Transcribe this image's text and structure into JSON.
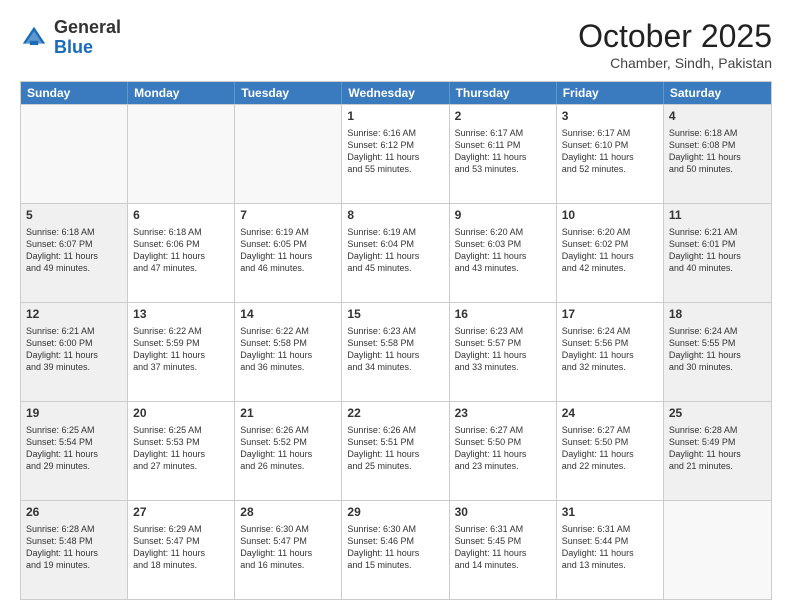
{
  "header": {
    "logo_general": "General",
    "logo_blue": "Blue",
    "month_title": "October 2025",
    "location": "Chamber, Sindh, Pakistan"
  },
  "weekdays": [
    "Sunday",
    "Monday",
    "Tuesday",
    "Wednesday",
    "Thursday",
    "Friday",
    "Saturday"
  ],
  "weeks": [
    [
      {
        "day": "",
        "info": "",
        "empty": true
      },
      {
        "day": "",
        "info": "",
        "empty": true
      },
      {
        "day": "",
        "info": "",
        "empty": true
      },
      {
        "day": "1",
        "info": "Sunrise: 6:16 AM\nSunset: 6:12 PM\nDaylight: 11 hours\nand 55 minutes.",
        "empty": false
      },
      {
        "day": "2",
        "info": "Sunrise: 6:17 AM\nSunset: 6:11 PM\nDaylight: 11 hours\nand 53 minutes.",
        "empty": false
      },
      {
        "day": "3",
        "info": "Sunrise: 6:17 AM\nSunset: 6:10 PM\nDaylight: 11 hours\nand 52 minutes.",
        "empty": false
      },
      {
        "day": "4",
        "info": "Sunrise: 6:18 AM\nSunset: 6:08 PM\nDaylight: 11 hours\nand 50 minutes.",
        "empty": false,
        "shaded": true
      }
    ],
    [
      {
        "day": "5",
        "info": "Sunrise: 6:18 AM\nSunset: 6:07 PM\nDaylight: 11 hours\nand 49 minutes.",
        "empty": false,
        "shaded": true
      },
      {
        "day": "6",
        "info": "Sunrise: 6:18 AM\nSunset: 6:06 PM\nDaylight: 11 hours\nand 47 minutes.",
        "empty": false
      },
      {
        "day": "7",
        "info": "Sunrise: 6:19 AM\nSunset: 6:05 PM\nDaylight: 11 hours\nand 46 minutes.",
        "empty": false
      },
      {
        "day": "8",
        "info": "Sunrise: 6:19 AM\nSunset: 6:04 PM\nDaylight: 11 hours\nand 45 minutes.",
        "empty": false
      },
      {
        "day": "9",
        "info": "Sunrise: 6:20 AM\nSunset: 6:03 PM\nDaylight: 11 hours\nand 43 minutes.",
        "empty": false
      },
      {
        "day": "10",
        "info": "Sunrise: 6:20 AM\nSunset: 6:02 PM\nDaylight: 11 hours\nand 42 minutes.",
        "empty": false
      },
      {
        "day": "11",
        "info": "Sunrise: 6:21 AM\nSunset: 6:01 PM\nDaylight: 11 hours\nand 40 minutes.",
        "empty": false,
        "shaded": true
      }
    ],
    [
      {
        "day": "12",
        "info": "Sunrise: 6:21 AM\nSunset: 6:00 PM\nDaylight: 11 hours\nand 39 minutes.",
        "empty": false,
        "shaded": true
      },
      {
        "day": "13",
        "info": "Sunrise: 6:22 AM\nSunset: 5:59 PM\nDaylight: 11 hours\nand 37 minutes.",
        "empty": false
      },
      {
        "day": "14",
        "info": "Sunrise: 6:22 AM\nSunset: 5:58 PM\nDaylight: 11 hours\nand 36 minutes.",
        "empty": false
      },
      {
        "day": "15",
        "info": "Sunrise: 6:23 AM\nSunset: 5:58 PM\nDaylight: 11 hours\nand 34 minutes.",
        "empty": false
      },
      {
        "day": "16",
        "info": "Sunrise: 6:23 AM\nSunset: 5:57 PM\nDaylight: 11 hours\nand 33 minutes.",
        "empty": false
      },
      {
        "day": "17",
        "info": "Sunrise: 6:24 AM\nSunset: 5:56 PM\nDaylight: 11 hours\nand 32 minutes.",
        "empty": false
      },
      {
        "day": "18",
        "info": "Sunrise: 6:24 AM\nSunset: 5:55 PM\nDaylight: 11 hours\nand 30 minutes.",
        "empty": false,
        "shaded": true
      }
    ],
    [
      {
        "day": "19",
        "info": "Sunrise: 6:25 AM\nSunset: 5:54 PM\nDaylight: 11 hours\nand 29 minutes.",
        "empty": false,
        "shaded": true
      },
      {
        "day": "20",
        "info": "Sunrise: 6:25 AM\nSunset: 5:53 PM\nDaylight: 11 hours\nand 27 minutes.",
        "empty": false
      },
      {
        "day": "21",
        "info": "Sunrise: 6:26 AM\nSunset: 5:52 PM\nDaylight: 11 hours\nand 26 minutes.",
        "empty": false
      },
      {
        "day": "22",
        "info": "Sunrise: 6:26 AM\nSunset: 5:51 PM\nDaylight: 11 hours\nand 25 minutes.",
        "empty": false
      },
      {
        "day": "23",
        "info": "Sunrise: 6:27 AM\nSunset: 5:50 PM\nDaylight: 11 hours\nand 23 minutes.",
        "empty": false
      },
      {
        "day": "24",
        "info": "Sunrise: 6:27 AM\nSunset: 5:50 PM\nDaylight: 11 hours\nand 22 minutes.",
        "empty": false
      },
      {
        "day": "25",
        "info": "Sunrise: 6:28 AM\nSunset: 5:49 PM\nDaylight: 11 hours\nand 21 minutes.",
        "empty": false,
        "shaded": true
      }
    ],
    [
      {
        "day": "26",
        "info": "Sunrise: 6:28 AM\nSunset: 5:48 PM\nDaylight: 11 hours\nand 19 minutes.",
        "empty": false,
        "shaded": true
      },
      {
        "day": "27",
        "info": "Sunrise: 6:29 AM\nSunset: 5:47 PM\nDaylight: 11 hours\nand 18 minutes.",
        "empty": false
      },
      {
        "day": "28",
        "info": "Sunrise: 6:30 AM\nSunset: 5:47 PM\nDaylight: 11 hours\nand 16 minutes.",
        "empty": false
      },
      {
        "day": "29",
        "info": "Sunrise: 6:30 AM\nSunset: 5:46 PM\nDaylight: 11 hours\nand 15 minutes.",
        "empty": false
      },
      {
        "day": "30",
        "info": "Sunrise: 6:31 AM\nSunset: 5:45 PM\nDaylight: 11 hours\nand 14 minutes.",
        "empty": false
      },
      {
        "day": "31",
        "info": "Sunrise: 6:31 AM\nSunset: 5:44 PM\nDaylight: 11 hours\nand 13 minutes.",
        "empty": false
      },
      {
        "day": "",
        "info": "",
        "empty": true,
        "shaded": true
      }
    ]
  ]
}
